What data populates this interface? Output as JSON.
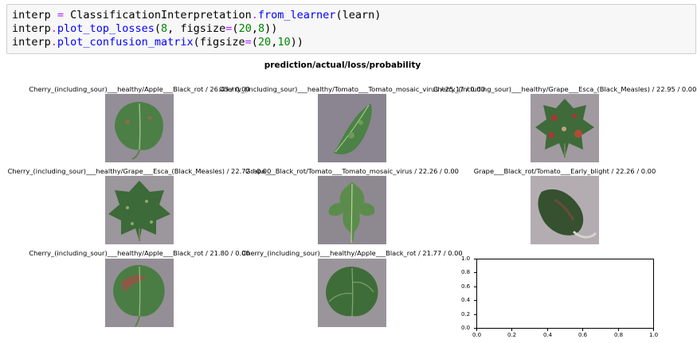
{
  "code": {
    "line1": {
      "var": "interp",
      "op": " = ",
      "cls": "ClassificationInterpretation",
      "dot": ".",
      "method": "from_learner",
      "args": "(learn)"
    },
    "line2": {
      "var": "interp",
      "dot": ".",
      "method": "plot_top_losses",
      "open": "(",
      "n": "8",
      "sep": ", figsize",
      "eq": "=",
      "tuple_open": "(",
      "a": "20",
      "comma": ",",
      "b": "8",
      "close": "))"
    },
    "line3": {
      "var": "interp",
      "dot": ".",
      "method": "plot_confusion_matrix",
      "open": "(figsize",
      "eq": "=",
      "tuple_open": "(",
      "a": "20",
      "comma": ",",
      "b": "10",
      "close": "))"
    }
  },
  "figure": {
    "title": "prediction/actual/loss/probability",
    "panels": [
      {
        "label": "Cherry_(including_sour)___healthy/Apple___Black_rot / 26.43 / 0.00",
        "leaf": "apple"
      },
      {
        "label": "Cherry_(including_sour)___healthy/Tomato___Tomato_mosaic_virus / 25.17 / 0.00",
        "leaf": "tomato-narrow"
      },
      {
        "label": "Cherry_(including_sour)___healthy/Grape___Esca_(Black_Measles) / 22.95 / 0.00",
        "leaf": "grape-red"
      },
      {
        "label": "Cherry_(including_sour)___healthy/Grape___Esca_(Black_Measles) / 22.72 / 0.00",
        "leaf": "grape-spotty"
      },
      {
        "label": "Grape___Black_rot/Tomato___Tomato_mosaic_virus / 22.26 / 0.00",
        "leaf": "tomato-compound"
      },
      {
        "label": "Grape___Black_rot/Tomato___Early_blight / 22.26 / 0.00",
        "leaf": "tomato-curled"
      },
      {
        "label": "Cherry_(including_sour)___healthy/Apple___Black_rot / 21.80 / 0.00",
        "leaf": "apple-blotch"
      },
      {
        "label": "Cherry_(including_sour)___healthy/Apple___Black_rot / 21.77 / 0.00",
        "leaf": "apple-healthy"
      }
    ],
    "empty_axes": {
      "xticks": [
        "0.0",
        "0.2",
        "0.4",
        "0.6",
        "0.8",
        "1.0"
      ],
      "yticks": [
        "0.0",
        "0.2",
        "0.4",
        "0.6",
        "0.8",
        "1.0"
      ]
    }
  },
  "colors": {
    "leaf_bg": "#8d8790",
    "leaf_green": "#3f6e3a",
    "leaf_light": "#7da65a",
    "lesion": "#8a4b3a",
    "code_bg": "#f7f7f7"
  }
}
